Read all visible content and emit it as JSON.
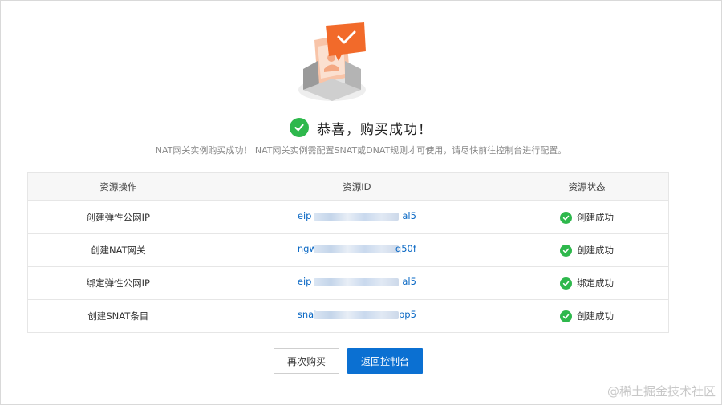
{
  "header": {
    "title": "恭喜，购买成功！",
    "subtitle": "NAT网关实例购买成功！ NAT网关实例需配置SNAT或DNAT规则才可使用，请尽快前往控制台进行配置。"
  },
  "table": {
    "columns": [
      "资源操作",
      "资源ID",
      "资源状态"
    ],
    "rows": [
      {
        "operation": "创建弹性公网IP",
        "id_prefix": "eip",
        "id_suffix": "al5",
        "status": "创建成功"
      },
      {
        "operation": "创建NAT网关",
        "id_prefix": "ngw",
        "id_suffix": "q50f",
        "status": "创建成功"
      },
      {
        "operation": "绑定弹性公网IP",
        "id_prefix": "eip",
        "id_suffix": "al5",
        "status": "绑定成功"
      },
      {
        "operation": "创建SNAT条目",
        "id_prefix": "snat",
        "id_suffix": "pp5",
        "status": "创建成功"
      }
    ]
  },
  "buttons": {
    "buy_again": "再次购买",
    "back_to_console": "返回控制台"
  },
  "watermark": "@稀土掘金技术社区",
  "colors": {
    "success": "#2eb84c",
    "primary": "#0b70d2",
    "link": "#0a68c4",
    "illustration_accent": "#f26a2a"
  },
  "icons": {
    "illustration": "purchase-success-envelope-icon",
    "title": "success-check-icon",
    "status": "check-circle-icon"
  }
}
